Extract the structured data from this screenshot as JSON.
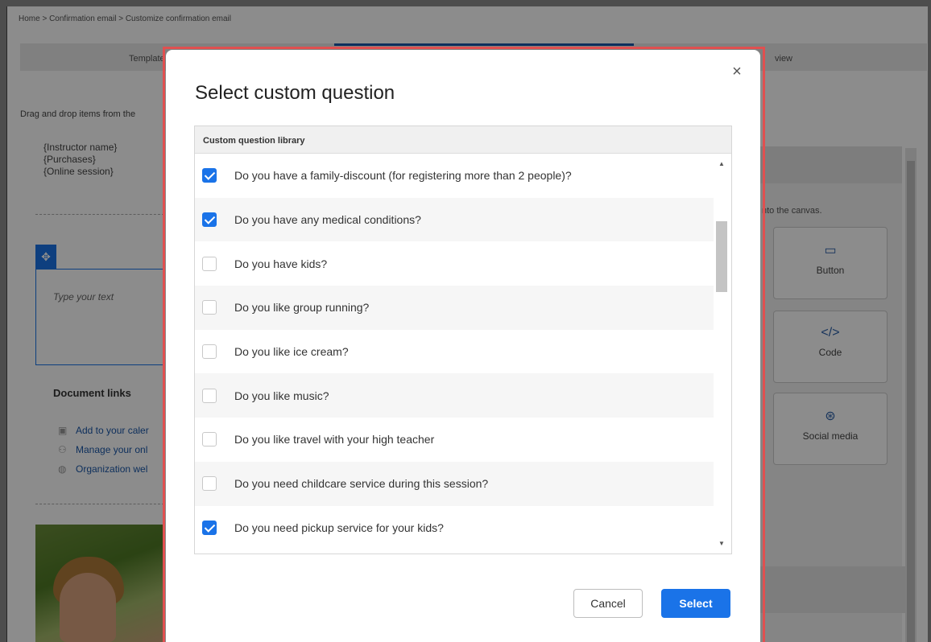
{
  "breadcrumb": "Home > Confirmation email > Customize confirmation email",
  "steps": {
    "template_label": "Template",
    "preview_label": "view"
  },
  "hint_text": "Drag and drop items from the",
  "merge_fields": [
    "{Instructor name}",
    "{Purchases}",
    "{Online session}"
  ],
  "text_placeholder": "Type your text",
  "document_links": {
    "title": "Document links",
    "items": [
      {
        "label": "Add to your caler",
        "icon": "calendar-icon"
      },
      {
        "label": "Manage your onl",
        "icon": "users-icon"
      },
      {
        "label": "Organization wel",
        "icon": "globe-icon"
      }
    ]
  },
  "right_panel": {
    "drag_hint": "nto the canvas.",
    "tiles": [
      {
        "label": "Button",
        "icon": "button-icon"
      },
      {
        "label": "Code",
        "icon": "code-icon"
      },
      {
        "label": "Social media",
        "icon": "social-media-icon"
      }
    ]
  },
  "modal": {
    "title": "Select custom question",
    "close_label": "×",
    "library_header": "Custom question library",
    "questions": [
      {
        "label": "Do you have a family-discount (for registering more than 2 people)?",
        "checked": true
      },
      {
        "label": "Do you have any medical conditions?",
        "checked": true
      },
      {
        "label": "Do you have kids?",
        "checked": false
      },
      {
        "label": "Do you like group running?",
        "checked": false
      },
      {
        "label": "Do you like ice cream?",
        "checked": false
      },
      {
        "label": "Do you like music?",
        "checked": false
      },
      {
        "label": "Do you like travel with your high teacher",
        "checked": false
      },
      {
        "label": "Do you need childcare service during this session?",
        "checked": false
      },
      {
        "label": "Do you need pickup service for your kids?",
        "checked": true
      }
    ],
    "cancel_label": "Cancel",
    "select_label": "Select"
  },
  "colors": {
    "accent": "#1a73e8",
    "highlight_border": "#e05050"
  }
}
